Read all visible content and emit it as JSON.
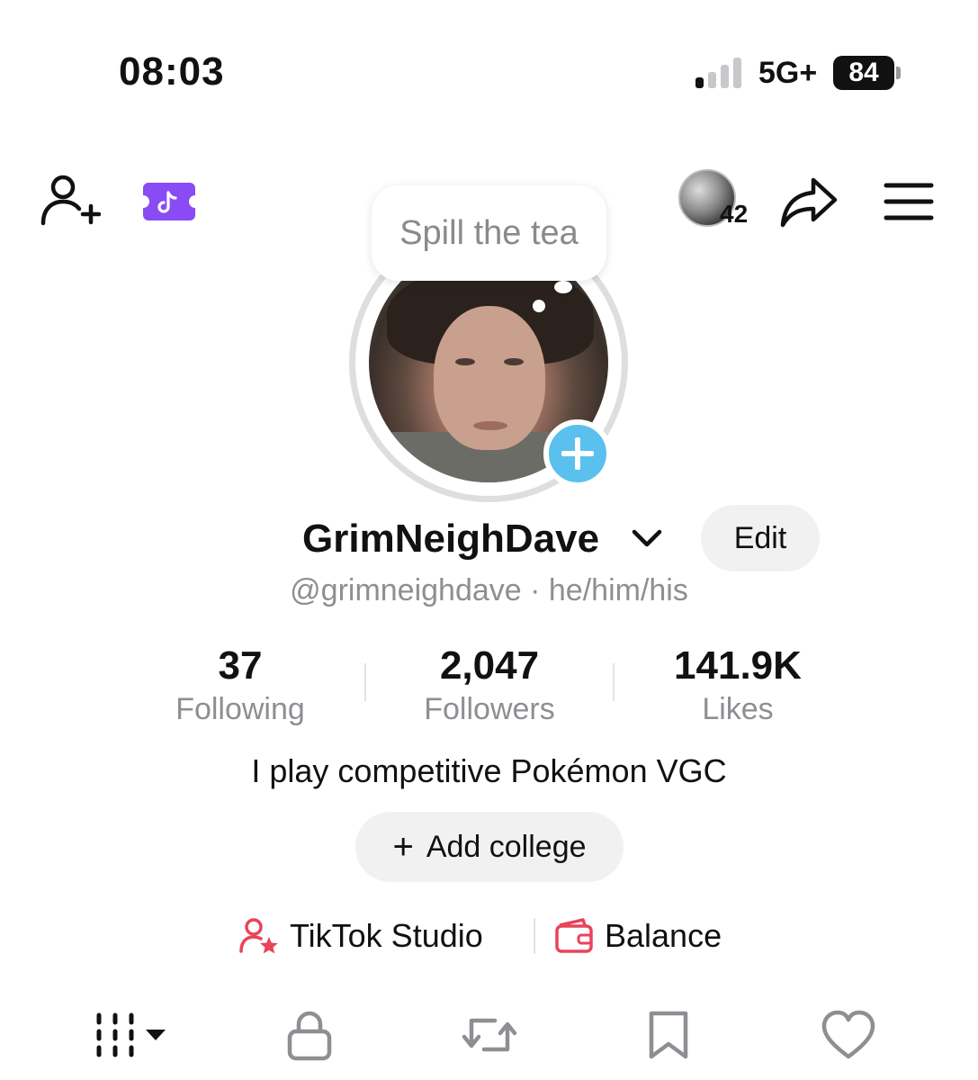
{
  "status_bar": {
    "time": "08:03",
    "network": "5G+",
    "battery": "84"
  },
  "top_bar": {
    "stories_count": "42"
  },
  "bubble": {
    "text": "Spill the tea"
  },
  "profile": {
    "name": "GrimNeighDave",
    "edit_label": "Edit",
    "handle_line": "@grimneighdave · he/him/his",
    "bio": "I play competitive Pokémon VGC",
    "college_label": "Add college",
    "college_plus": "+"
  },
  "stats": [
    {
      "value": "37",
      "label": "Following"
    },
    {
      "value": "2,047",
      "label": "Followers"
    },
    {
      "value": "141.9K",
      "label": "Likes"
    }
  ],
  "links": {
    "studio": "TikTok Studio",
    "balance": "Balance"
  },
  "colors": {
    "accent_blue": "#5ac0ee",
    "ticket_purple": "#8a4bf5",
    "studio_red": "#e8445a",
    "muted_text": "#8e8e93"
  },
  "tabs": [
    {
      "icon": "grid-icon"
    },
    {
      "icon": "lock-icon"
    },
    {
      "icon": "repost-icon"
    },
    {
      "icon": "bookmark-icon"
    },
    {
      "icon": "heart-icon"
    }
  ]
}
